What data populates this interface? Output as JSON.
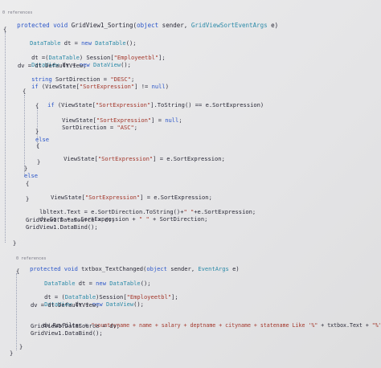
{
  "code": {
    "refs_1": "0 references",
    "sig1": {
      "mod": "protected void",
      "name": " GridView1_Sorting(",
      "t1": "object",
      "a1": " sender, ",
      "t2": "GridViewSortEventArgs",
      "a2": " e)"
    },
    "l_open1": "{",
    "l_dt": {
      "t": "DataTable",
      "a": " dt = ",
      "k": "new",
      "t2": " DataTable",
      "b": "();"
    },
    "l_cast": {
      "a": "dt =(",
      "t": "DataTable",
      "b": ") Session[",
      "s": "\"Employeetbl\"",
      "c": "];"
    },
    "l_dv": {
      "t": "DataView",
      "a": " dv = ",
      "k": "new",
      "t2": " DataView",
      "b": "();"
    },
    "l_dvdef": "dv = dt.DefaultView;",
    "l_sd": {
      "k": "string",
      "a": " SortDirection = ",
      "s": "\"DESC\"",
      "b": ";"
    },
    "l_if1": {
      "k": "if",
      "a": " (ViewState[",
      "s": "\"SortExpression\"",
      "b": "] != ",
      "k2": "null",
      "c": ")"
    },
    "l_open2": "{",
    "l_if2": {
      "k": "if",
      "a": " (ViewState[",
      "s": "\"SortExpression\"",
      "b": "].ToString() == e.SortExpression)"
    },
    "l_open3": "{",
    "l_vsnull": {
      "a": "ViewState[",
      "s": "\"SortExpression\"",
      "b": "] = ",
      "k": "null",
      "c": ";"
    },
    "l_asc": {
      "a": "SortDirection = ",
      "s": "\"ASC\"",
      "b": ";"
    },
    "l_close3": "}",
    "l_else1": "else",
    "l_open4": "{",
    "l_vsset1": {
      "a": "ViewState[",
      "s": "\"SortExpression\"",
      "b": "] = e.SortExpression;"
    },
    "l_close4": "}",
    "l_close2": "}",
    "l_else2": "else",
    "l_open5": "{",
    "l_vsset2": {
      "a": "ViewState[",
      "s": "\"SortExpression\"",
      "b": "] = e.SortExpression;"
    },
    "l_close5": "}",
    "l_lbl": {
      "a": "lbltext.Text = e.SortDirection.ToString()+",
      "s": "\" \"",
      "b": "+e.SortExpression;"
    },
    "l_sort": {
      "a": "dv.Sort = e.SortExpression + ",
      "s": "\" \"",
      "b": " + SortDirection;"
    },
    "l_ds1": "GridView1.DataSource = dv;",
    "l_db1": "GridView1.DataBind();",
    "l_close1": "}",
    "refs_2": "0 references",
    "sig2": {
      "mod": "protected void",
      "name": " txtbox_TextChanged(",
      "t1": "object",
      "a1": " sender, ",
      "t2": "EventArgs",
      "a2": " e)"
    },
    "l_open6": "{",
    "l_dt2": {
      "t": "DataTable",
      "a": " dt = ",
      "k": "new",
      "t2": " DataTable",
      "b": "();"
    },
    "l_cast2": {
      "a": "dt = (",
      "t": "DataTable",
      "b": ")Session[",
      "s": "\"Employeetbl\"",
      "c": "];"
    },
    "l_dv2": {
      "t": "DataView",
      "a": " dv = ",
      "k": "new",
      "t2": " DataView",
      "b": "();"
    },
    "l_dvdef2": "dv = dt.DefaultView;",
    "l_filter": {
      "a": "dv.RowFilter = ",
      "s": "\"countryname + name + salary + deptname + cityname + statename Like '%\"",
      "b": " + txtbox.Text + ",
      "s2": "\"%'\"",
      "c": ";"
    },
    "l_ds2": "GridView1.DataSource = dv;",
    "l_db2": "GridView1.DataBind();",
    "l_close6": "}",
    "l_close7": "}"
  }
}
